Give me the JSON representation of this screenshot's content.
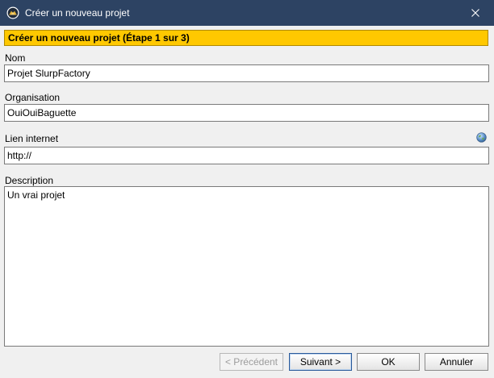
{
  "window": {
    "title": "Créer un nouveau projet"
  },
  "header": {
    "step_title": "Créer un nouveau projet (Étape 1 sur 3)"
  },
  "form": {
    "name_label": "Nom",
    "name_value": "Projet SlurpFactory",
    "organization_label": "Organisation",
    "organization_value": "OuiOuiBaguette",
    "link_label": "Lien internet",
    "link_value": "http://",
    "description_label": "Description",
    "description_value": "Un vrai projet"
  },
  "buttons": {
    "previous": "< Précédent",
    "next": "Suivant >",
    "ok": "OK",
    "cancel": "Annuler"
  },
  "icons": {
    "app": "app-logo-icon",
    "close": "close-icon",
    "globe": "globe-icon"
  },
  "colors": {
    "titlebar": "#2d4363",
    "step_header": "#ffc800"
  }
}
